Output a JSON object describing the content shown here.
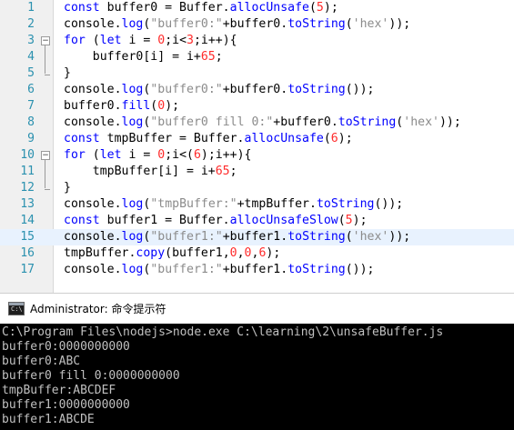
{
  "editor": {
    "lines": [
      {
        "num": "1",
        "highlight": false,
        "fold": "",
        "tokens": [
          {
            "t": "kw",
            "v": "const "
          },
          {
            "t": "tx",
            "v": "buffer0 = Buffer."
          },
          {
            "t": "fn",
            "v": "allocUnsafe"
          },
          {
            "t": "tx",
            "v": "("
          },
          {
            "t": "nm",
            "v": "5"
          },
          {
            "t": "tx",
            "v": ");"
          }
        ]
      },
      {
        "num": "2",
        "highlight": false,
        "fold": "",
        "tokens": [
          {
            "t": "tx",
            "v": "console."
          },
          {
            "t": "fn",
            "v": "log"
          },
          {
            "t": "tx",
            "v": "("
          },
          {
            "t": "st",
            "v": "\"buffer0:\""
          },
          {
            "t": "tx",
            "v": "+buffer0."
          },
          {
            "t": "fn",
            "v": "toString"
          },
          {
            "t": "tx",
            "v": "("
          },
          {
            "t": "st",
            "v": "'hex'"
          },
          {
            "t": "tx",
            "v": "));"
          }
        ]
      },
      {
        "num": "3",
        "highlight": false,
        "fold": "open",
        "tokens": [
          {
            "t": "kw",
            "v": "for"
          },
          {
            "t": "tx",
            "v": " ("
          },
          {
            "t": "kw",
            "v": "let"
          },
          {
            "t": "tx",
            "v": " i = "
          },
          {
            "t": "nm",
            "v": "0"
          },
          {
            "t": "tx",
            "v": ";i<"
          },
          {
            "t": "nm",
            "v": "3"
          },
          {
            "t": "tx",
            "v": ";i++){"
          }
        ]
      },
      {
        "num": "4",
        "highlight": false,
        "fold": "mid",
        "tokens": [
          {
            "t": "tx",
            "v": "    buffer0[i] = i+"
          },
          {
            "t": "nm",
            "v": "65"
          },
          {
            "t": "tx",
            "v": ";"
          }
        ]
      },
      {
        "num": "5",
        "highlight": false,
        "fold": "end",
        "tokens": [
          {
            "t": "tx",
            "v": "}"
          }
        ]
      },
      {
        "num": "6",
        "highlight": false,
        "fold": "",
        "tokens": [
          {
            "t": "tx",
            "v": "console."
          },
          {
            "t": "fn",
            "v": "log"
          },
          {
            "t": "tx",
            "v": "("
          },
          {
            "t": "st",
            "v": "\"buffer0:\""
          },
          {
            "t": "tx",
            "v": "+buffer0."
          },
          {
            "t": "fn",
            "v": "toString"
          },
          {
            "t": "tx",
            "v": "());"
          }
        ]
      },
      {
        "num": "7",
        "highlight": false,
        "fold": "",
        "tokens": [
          {
            "t": "tx",
            "v": "buffer0."
          },
          {
            "t": "fn",
            "v": "fill"
          },
          {
            "t": "tx",
            "v": "("
          },
          {
            "t": "nm",
            "v": "0"
          },
          {
            "t": "tx",
            "v": ");"
          }
        ]
      },
      {
        "num": "8",
        "highlight": false,
        "fold": "",
        "tokens": [
          {
            "t": "tx",
            "v": "console."
          },
          {
            "t": "fn",
            "v": "log"
          },
          {
            "t": "tx",
            "v": "("
          },
          {
            "t": "st",
            "v": "\"buffer0 fill 0:\""
          },
          {
            "t": "tx",
            "v": "+buffer0."
          },
          {
            "t": "fn",
            "v": "toString"
          },
          {
            "t": "tx",
            "v": "("
          },
          {
            "t": "st",
            "v": "'hex'"
          },
          {
            "t": "tx",
            "v": "));"
          }
        ]
      },
      {
        "num": "9",
        "highlight": false,
        "fold": "",
        "tokens": [
          {
            "t": "kw",
            "v": "const "
          },
          {
            "t": "tx",
            "v": "tmpBuffer = Buffer."
          },
          {
            "t": "fn",
            "v": "allocUnsafe"
          },
          {
            "t": "tx",
            "v": "("
          },
          {
            "t": "nm",
            "v": "6"
          },
          {
            "t": "tx",
            "v": ");"
          }
        ]
      },
      {
        "num": "10",
        "highlight": false,
        "fold": "open",
        "tokens": [
          {
            "t": "kw",
            "v": "for"
          },
          {
            "t": "tx",
            "v": " ("
          },
          {
            "t": "kw",
            "v": "let"
          },
          {
            "t": "tx",
            "v": " i = "
          },
          {
            "t": "nm",
            "v": "0"
          },
          {
            "t": "tx",
            "v": ";i<("
          },
          {
            "t": "nm",
            "v": "6"
          },
          {
            "t": "tx",
            "v": ");i++){"
          }
        ]
      },
      {
        "num": "11",
        "highlight": false,
        "fold": "mid",
        "tokens": [
          {
            "t": "tx",
            "v": "    tmpBuffer[i] = i+"
          },
          {
            "t": "nm",
            "v": "65"
          },
          {
            "t": "tx",
            "v": ";"
          }
        ]
      },
      {
        "num": "12",
        "highlight": false,
        "fold": "end",
        "tokens": [
          {
            "t": "tx",
            "v": "}"
          }
        ]
      },
      {
        "num": "13",
        "highlight": false,
        "fold": "",
        "tokens": [
          {
            "t": "tx",
            "v": "console."
          },
          {
            "t": "fn",
            "v": "log"
          },
          {
            "t": "tx",
            "v": "("
          },
          {
            "t": "st",
            "v": "\"tmpBuffer:\""
          },
          {
            "t": "tx",
            "v": "+tmpBuffer."
          },
          {
            "t": "fn",
            "v": "toString"
          },
          {
            "t": "tx",
            "v": "());"
          }
        ]
      },
      {
        "num": "14",
        "highlight": false,
        "fold": "",
        "tokens": [
          {
            "t": "kw",
            "v": "const "
          },
          {
            "t": "tx",
            "v": "buffer1 = Buffer."
          },
          {
            "t": "fn",
            "v": "allocUnsafeSlow"
          },
          {
            "t": "tx",
            "v": "("
          },
          {
            "t": "nm",
            "v": "5"
          },
          {
            "t": "tx",
            "v": ");"
          }
        ]
      },
      {
        "num": "15",
        "highlight": true,
        "fold": "",
        "tokens": [
          {
            "t": "tx",
            "v": "console."
          },
          {
            "t": "fn",
            "v": "log"
          },
          {
            "t": "tx",
            "v": "("
          },
          {
            "t": "st",
            "v": "\"buffer1:\""
          },
          {
            "t": "tx",
            "v": "+buffer1."
          },
          {
            "t": "fn",
            "v": "toString"
          },
          {
            "t": "tx",
            "v": "("
          },
          {
            "t": "st",
            "v": "'hex'"
          },
          {
            "t": "tx",
            "v": "));"
          }
        ]
      },
      {
        "num": "16",
        "highlight": false,
        "fold": "",
        "tokens": [
          {
            "t": "tx",
            "v": "tmpBuffer."
          },
          {
            "t": "fn",
            "v": "copy"
          },
          {
            "t": "tx",
            "v": "(buffer1,"
          },
          {
            "t": "nm",
            "v": "0"
          },
          {
            "t": "tx",
            "v": ","
          },
          {
            "t": "nm",
            "v": "0"
          },
          {
            "t": "tx",
            "v": ","
          },
          {
            "t": "nm",
            "v": "6"
          },
          {
            "t": "tx",
            "v": ");"
          }
        ]
      },
      {
        "num": "17",
        "highlight": false,
        "fold": "",
        "tokens": [
          {
            "t": "tx",
            "v": "console."
          },
          {
            "t": "fn",
            "v": "log"
          },
          {
            "t": "tx",
            "v": "("
          },
          {
            "t": "st",
            "v": "\"buffer1:\""
          },
          {
            "t": "tx",
            "v": "+buffer1."
          },
          {
            "t": "fn",
            "v": "toString"
          },
          {
            "t": "tx",
            "v": "());"
          }
        ]
      }
    ]
  },
  "console": {
    "title": "Administrator: 命令提示符",
    "icon": "cmd-window-icon",
    "output": [
      "C:\\Program Files\\nodejs>node.exe C:\\learning\\2\\unsafeBuffer.js",
      "buffer0:0000000000",
      "buffer0:ABC",
      "buffer0 fill 0:0000000000",
      "tmpBuffer:ABCDEF",
      "buffer1:0000000000",
      "buffer1:ABCDE"
    ]
  },
  "colors": {
    "keyword": "#0000ff",
    "string": "#8b8b8b",
    "number": "#ff2a2a",
    "line_number": "#2b91af",
    "highlight_line": "#e8f2fe",
    "console_bg": "#000000",
    "console_text": "#c0c0c0"
  }
}
